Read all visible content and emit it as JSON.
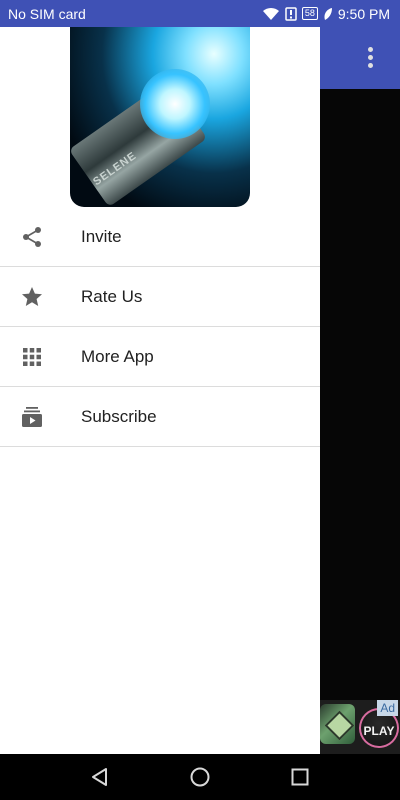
{
  "status_bar": {
    "carrier": "No SIM card",
    "battery_level": "58",
    "time": "9:50 PM"
  },
  "drawer": {
    "header_image_text": "SELENE",
    "menu_items": [
      {
        "label": "Invite",
        "icon": "share-icon"
      },
      {
        "label": "Rate Us",
        "icon": "star-icon"
      },
      {
        "label": "More App",
        "icon": "apps-grid-icon"
      },
      {
        "label": "Subscribe",
        "icon": "subscriptions-icon"
      }
    ]
  },
  "ad": {
    "badge": "Ad",
    "play_label": "PLAY"
  },
  "colors": {
    "primary": "#3F51B5",
    "menu_text": "#212121",
    "icon": "#616161"
  }
}
